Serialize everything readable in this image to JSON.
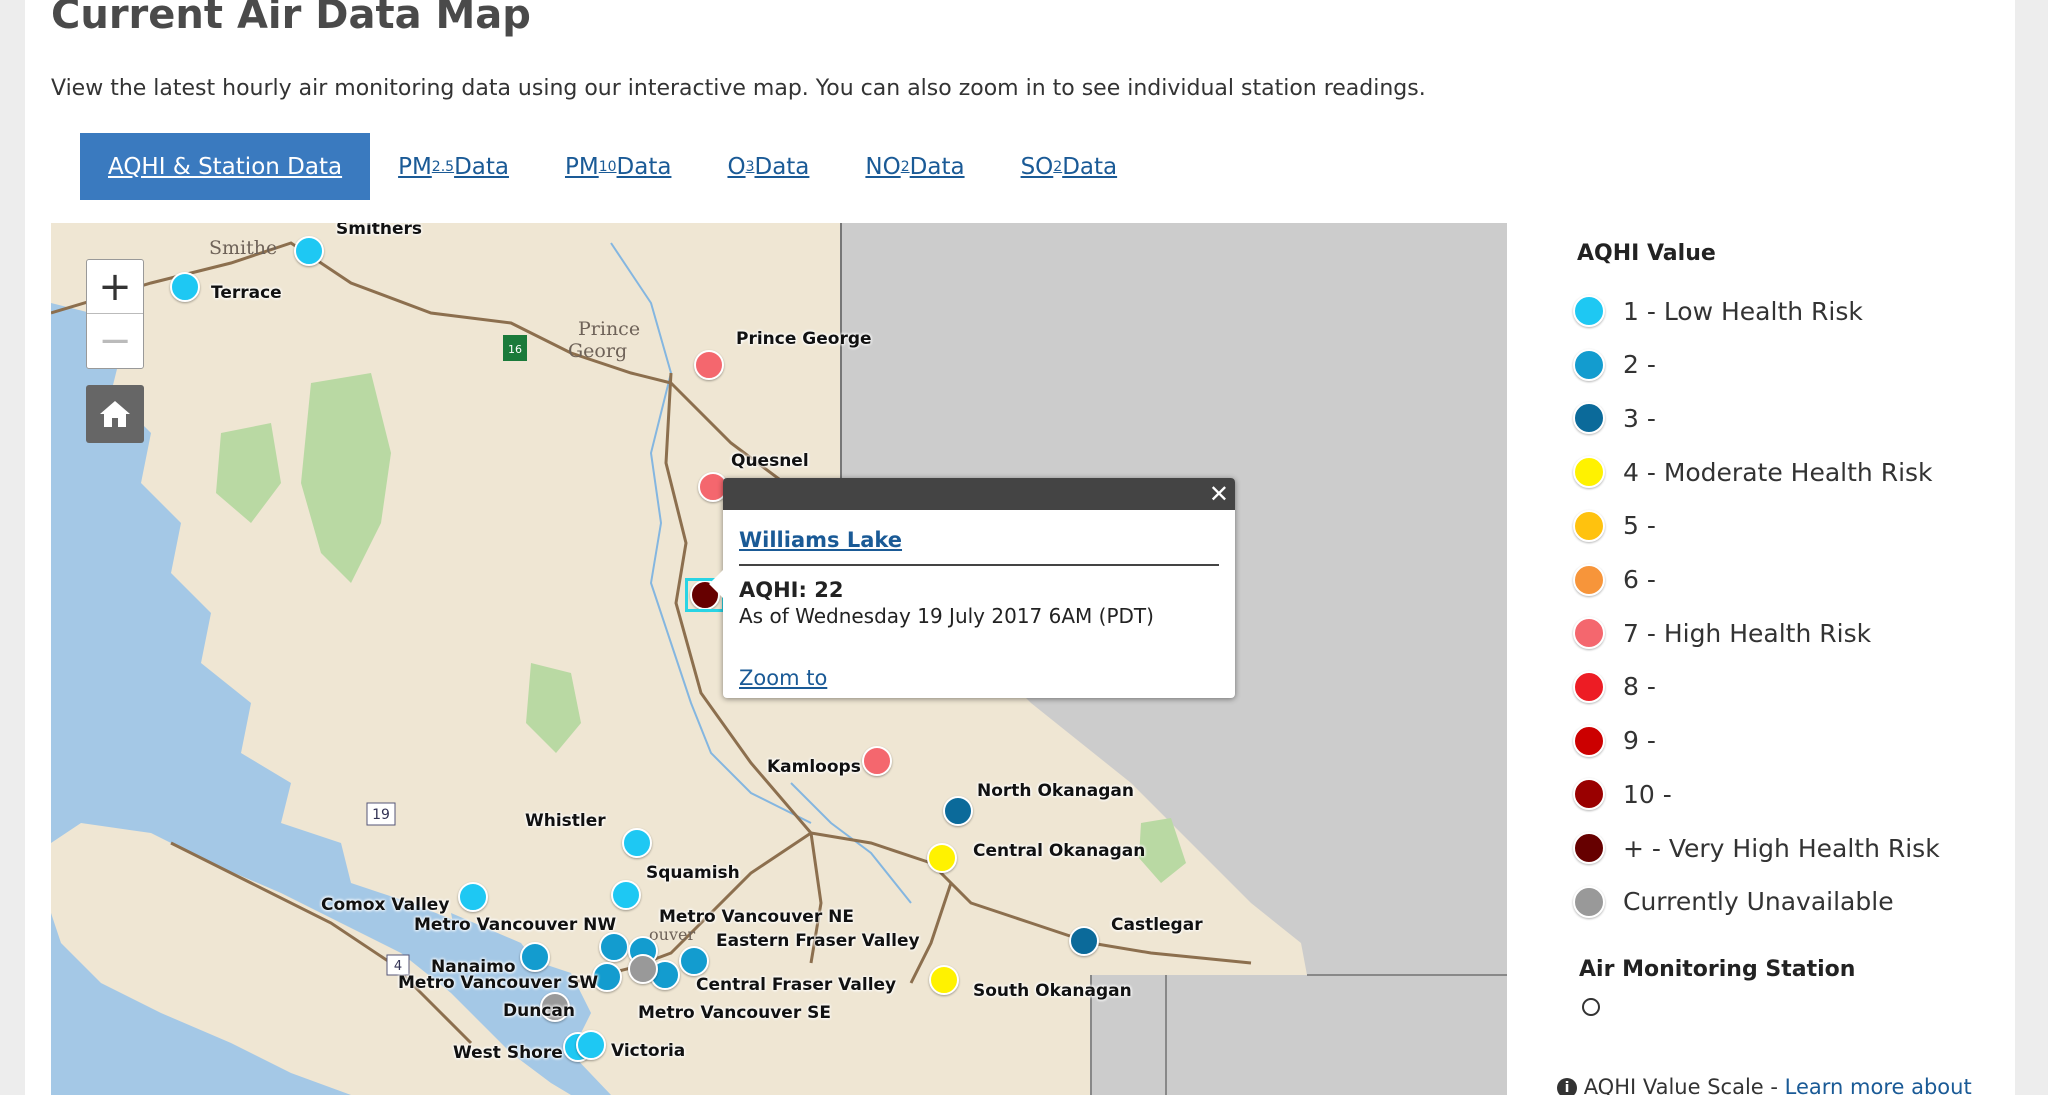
{
  "page": {
    "title": "Current Air Data Map",
    "intro": "View the latest hourly air monitoring data using our interactive map. You can also zoom in to see individual station readings."
  },
  "tabs": [
    {
      "main": "AQHI & Station Data",
      "sub": "",
      "after": "",
      "active": true
    },
    {
      "main": "PM",
      "sub": "2.5",
      "after": " Data",
      "active": false
    },
    {
      "main": "PM",
      "sub": "10",
      "after": " Data",
      "active": false
    },
    {
      "main": "O",
      "sub": "3",
      "after": " Data",
      "active": false
    },
    {
      "main": "NO",
      "sub": "2",
      "after": " Data",
      "active": false
    },
    {
      "main": "SO",
      "sub": "2",
      "after": " Data",
      "active": false
    }
  ],
  "colors": {
    "aqhi_1": "#1ec8f3",
    "aqhi_2": "#139ccf",
    "aqhi_3": "#0b6a9a",
    "aqhi_4": "#fff200",
    "aqhi_5": "#ffc20e",
    "aqhi_6": "#f7953a",
    "aqhi_7": "#f4676e",
    "aqhi_8": "#ed1c24",
    "aqhi_9": "#cc0000",
    "aqhi_10": "#990000",
    "aqhi_plus": "#660000",
    "unavailable": "#999999",
    "land": "#efe6d3",
    "water": "#a4c8e6",
    "outside": "#cccccc",
    "parks": "#b9d9a3",
    "roads": "#8c6f4e",
    "tab_active": "#3a7abf"
  },
  "map": {
    "zoom_in": "+",
    "zoom_out": "−",
    "town_labels": [
      "Smithe",
      "Prince",
      "Georg",
      "ouver"
    ],
    "highway_shields": [
      "16",
      "19",
      "4"
    ],
    "stations": [
      {
        "name": "Smithers",
        "level": "1"
      },
      {
        "name": "Terrace",
        "level": "1"
      },
      {
        "name": "Prince George",
        "level": "7"
      },
      {
        "name": "Quesnel",
        "level": "7"
      },
      {
        "name": "Williams Lake",
        "level": "plus"
      },
      {
        "name": "Kamloops",
        "level": "7"
      },
      {
        "name": "North Okanagan",
        "level": "3"
      },
      {
        "name": "Central Okanagan",
        "level": "4"
      },
      {
        "name": "South Okanagan",
        "level": "4"
      },
      {
        "name": "Castlegar",
        "level": "3"
      },
      {
        "name": "Whistler",
        "level": "1"
      },
      {
        "name": "Squamish",
        "level": "1"
      },
      {
        "name": "Comox Valley",
        "level": "1"
      },
      {
        "name": "Metro Vancouver NW",
        "level": "2"
      },
      {
        "name": "Metro Vancouver NE",
        "level": "2"
      },
      {
        "name": "Eastern Fraser Valley",
        "level": "2"
      },
      {
        "name": "Nanaimo",
        "level": "2"
      },
      {
        "name": "Metro Vancouver SW",
        "level": "2"
      },
      {
        "name": "Central Fraser Valley",
        "level": "2"
      },
      {
        "name": "Metro Vancouver SE",
        "level": "unavailable"
      },
      {
        "name": "Duncan",
        "level": "unavailable"
      },
      {
        "name": "West Shore",
        "level": "1"
      },
      {
        "name": "Victoria",
        "level": "1"
      }
    ]
  },
  "popup": {
    "close": "✕",
    "station": "Williams Lake",
    "aqhi": "AQHI: 22",
    "timestamp": "As of Wednesday 19 July 2017 6AM (PDT)",
    "zoom_link": "Zoom to"
  },
  "legend": {
    "title": "AQHI Value",
    "items": [
      {
        "label": "1 - Low Health Risk",
        "color": "#1ec8f3"
      },
      {
        "label": "2 -",
        "color": "#139ccf"
      },
      {
        "label": "3 -",
        "color": "#0b6a9a"
      },
      {
        "label": "4 - Moderate Health Risk",
        "color": "#fff200"
      },
      {
        "label": "5 -",
        "color": "#ffc20e"
      },
      {
        "label": "6 -",
        "color": "#f7953a"
      },
      {
        "label": "7 - High Health Risk",
        "color": "#f4676e"
      },
      {
        "label": "8 -",
        "color": "#ed1c24"
      },
      {
        "label": "9 -",
        "color": "#cc0000"
      },
      {
        "label": "10 -",
        "color": "#990000"
      },
      {
        "label": "+ - Very High Health Risk",
        "color": "#660000"
      },
      {
        "label": "Currently Unavailable",
        "color": "#999999"
      }
    ],
    "monitoring_title": "Air Monitoring Station",
    "scale_note": "AQHI Value Scale - ",
    "scale_link": "Learn more about"
  }
}
